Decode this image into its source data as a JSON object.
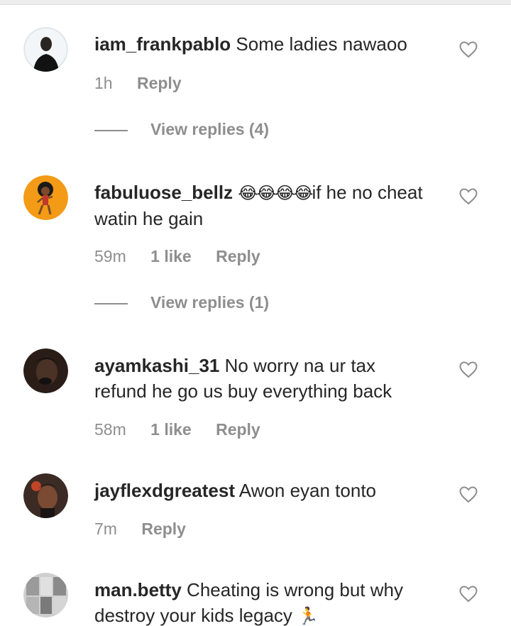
{
  "comments": [
    {
      "username": "iam_frankpablo",
      "text": "Some ladies nawaoo",
      "time": "1h",
      "likes": "",
      "reply": "Reply",
      "view_replies": "View replies (4)"
    },
    {
      "username": "fabuluose_bellz",
      "emojis": "😂😂😂😂",
      "text": "if he no cheat watin he gain",
      "time": "59m",
      "likes": "1 like",
      "reply": "Reply",
      "view_replies": "View replies (1)"
    },
    {
      "username": "ayamkashi_31",
      "text": "No worry na ur tax refund he go us buy everything back",
      "time": "58m",
      "likes": "1 like",
      "reply": "Reply"
    },
    {
      "username": "jayflexdgreatest",
      "text": "Awon eyan tonto",
      "time": "7m",
      "likes": "",
      "reply": "Reply"
    },
    {
      "username": "man.betty",
      "text": "Cheating is wrong but why destroy your kids legacy",
      "trailing_emoji": "🏃",
      "time": "",
      "likes": "",
      "reply": ""
    }
  ],
  "icons": {
    "like": "heart-outline-icon"
  },
  "colors": {
    "text": "#262626",
    "meta": "#8e8e8e",
    "heart": "#8e8e8e"
  }
}
